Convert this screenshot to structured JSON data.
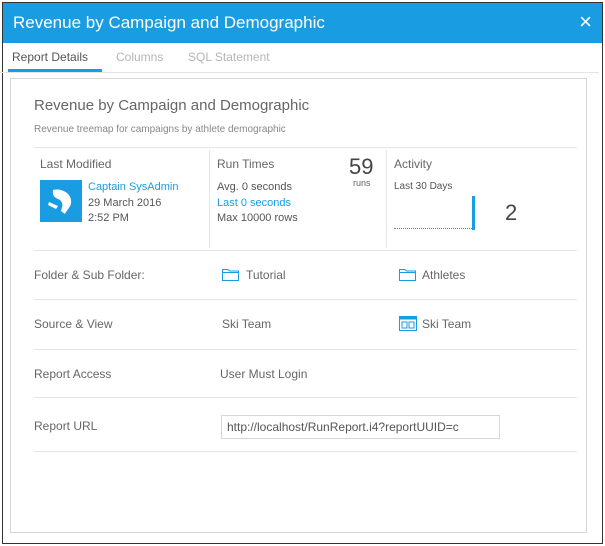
{
  "window": {
    "title": "Revenue by Campaign and Demographic",
    "close_glyph": "×"
  },
  "tabs": [
    {
      "label": "Report Details",
      "active": true
    },
    {
      "label": "Columns",
      "active": false
    },
    {
      "label": "SQL Statement",
      "active": false
    }
  ],
  "report": {
    "title": "Revenue by Campaign and Demographic",
    "description": "Revenue treemap for campaigns by athlete demographic"
  },
  "last_modified": {
    "heading": "Last Modified",
    "user": "Captain SysAdmin",
    "date": "29 March 2016",
    "time": "2:52 PM"
  },
  "run_times": {
    "heading": "Run Times",
    "count": "59",
    "count_label": "runs",
    "avg": "Avg. 0 seconds",
    "last": "Last 0 seconds",
    "max": "Max 10000 rows"
  },
  "activity": {
    "heading": "Activity",
    "period": "Last 30 Days",
    "count": "2",
    "sparkline_fraction_last_day": 1.0
  },
  "details": {
    "folder_label": "Folder & Sub Folder:",
    "folder": "Tutorial",
    "sub_folder": "Athletes",
    "source_label": "Source & View",
    "source": "Ski Team",
    "view": "Ski Team",
    "access_label": "Report Access",
    "access": "User Must Login",
    "url_label": "Report URL",
    "url": "http://localhost/RunReport.i4?reportUUID=c"
  },
  "colors": {
    "accent": "#1a9ce2",
    "title_bar": "#1a9ce2"
  },
  "icons": {
    "close": "close-icon",
    "avatar": "skier-avatar-icon",
    "folder": "folder-icon",
    "view": "view-icon"
  }
}
